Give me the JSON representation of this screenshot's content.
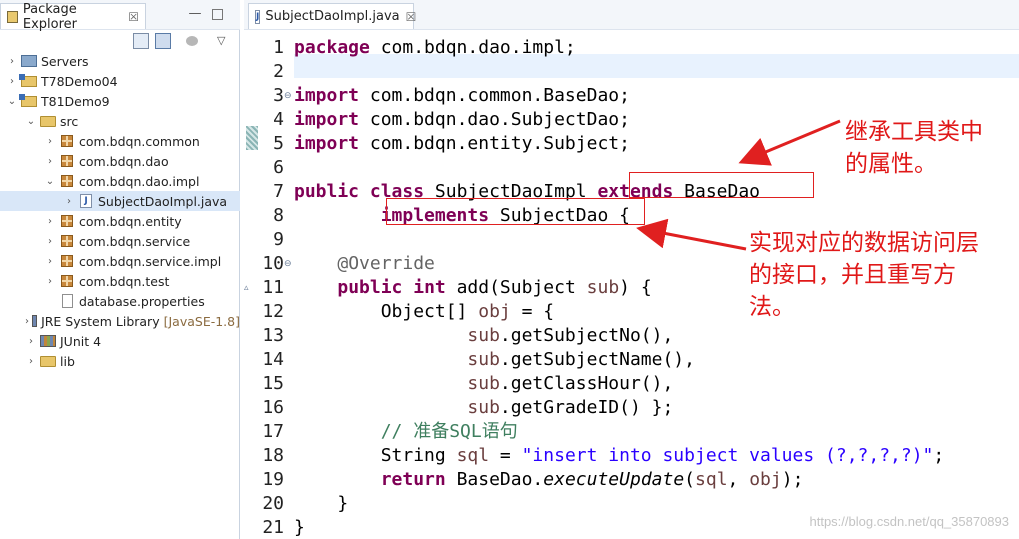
{
  "explorer": {
    "tab_label": "Package Explorer",
    "tab_close": "☒",
    "tree": [
      {
        "label": "Servers",
        "icon": "server-folder-icon",
        "twisty": "›",
        "indent": 0
      },
      {
        "label": "T78Demo04",
        "icon": "project-icon",
        "twisty": "›",
        "indent": 0
      },
      {
        "label": "T81Demo9",
        "icon": "project-icon",
        "twisty": "⌄",
        "indent": 0
      },
      {
        "label": "src",
        "icon": "source-folder-icon",
        "twisty": "⌄",
        "indent": 1
      },
      {
        "label": "com.bdqn.common",
        "icon": "package-icon",
        "twisty": "›",
        "indent": 2
      },
      {
        "label": "com.bdqn.dao",
        "icon": "package-icon",
        "twisty": "›",
        "indent": 2
      },
      {
        "label": "com.bdqn.dao.impl",
        "icon": "package-icon",
        "twisty": "⌄",
        "indent": 2
      },
      {
        "label": "SubjectDaoImpl.java",
        "icon": "java-file-icon",
        "twisty": "›",
        "indent": 3,
        "selected": true
      },
      {
        "label": "com.bdqn.entity",
        "icon": "package-icon",
        "twisty": "›",
        "indent": 2
      },
      {
        "label": "com.bdqn.service",
        "icon": "package-icon",
        "twisty": "›",
        "indent": 2
      },
      {
        "label": "com.bdqn.service.impl",
        "icon": "package-icon",
        "twisty": "›",
        "indent": 2
      },
      {
        "label": "com.bdqn.test",
        "icon": "package-icon",
        "twisty": "›",
        "indent": 2
      },
      {
        "label": "database.properties",
        "icon": "properties-file-icon",
        "twisty": "",
        "indent": 2
      },
      {
        "label": "JRE System Library",
        "suffix": "[JavaSE-1.8]",
        "icon": "library-icon",
        "twisty": "›",
        "indent": 1
      },
      {
        "label": "JUnit 4",
        "icon": "library-icon",
        "twisty": "›",
        "indent": 1
      },
      {
        "label": "lib",
        "icon": "folder-icon",
        "twisty": "›",
        "indent": 1
      }
    ]
  },
  "editor": {
    "tab_label": "SubjectDaoImpl.java",
    "tab_close": "☒",
    "java_badge": "J",
    "line_numbers": [
      "1",
      "2",
      "3",
      "4",
      "5",
      "6",
      "7",
      "8",
      "9",
      "10",
      "11",
      "12",
      "13",
      "14",
      "15",
      "16",
      "17",
      "18",
      "19",
      "20",
      "21"
    ],
    "code": {
      "l1": [
        "package",
        " com.bdqn.dao.impl;"
      ],
      "l3": [
        "import",
        " com.bdqn.common.BaseDao;"
      ],
      "l4": [
        "import",
        " com.bdqn.dao.SubjectDao;"
      ],
      "l5": [
        "import",
        " com.bdqn.entity.Subject;"
      ],
      "l7": [
        "public",
        " ",
        "class",
        " SubjectDaoImpl ",
        "extends",
        " BaseDao"
      ],
      "l8": [
        "        ",
        "implements",
        " SubjectDao",
        " {"
      ],
      "l10": [
        "    ",
        "@Override"
      ],
      "l11": [
        "    ",
        "public",
        " ",
        "int",
        " add(Subject ",
        "sub",
        ") {"
      ],
      "l12": [
        "        Object[] ",
        "obj",
        " = {"
      ],
      "l13": [
        "                ",
        "sub",
        ".getSubjectNo(),"
      ],
      "l14": [
        "                ",
        "sub",
        ".getSubjectName(),"
      ],
      "l15": [
        "                ",
        "sub",
        ".getClassHour(),"
      ],
      "l16": [
        "                ",
        "sub",
        ".getGradeID() };"
      ],
      "l17": [
        "        ",
        "// 准备SQL语句"
      ],
      "l18": [
        "        String ",
        "sql",
        " = ",
        "\"insert into subject values (?,?,?,?)\"",
        ";"
      ],
      "l19": [
        "        ",
        "return",
        " BaseDao.",
        "executeUpdate",
        "(",
        "sql",
        ", ",
        "obj",
        ");"
      ],
      "l20": [
        "    }"
      ],
      "l21": [
        "}"
      ]
    }
  },
  "annotations": {
    "note1": "继承工具类中\n的属性。",
    "note2": "实现对应的数据访问层\n的接口，并且重写方\n法。"
  },
  "watermark": "https://blog.csdn.net/qq_35870893"
}
